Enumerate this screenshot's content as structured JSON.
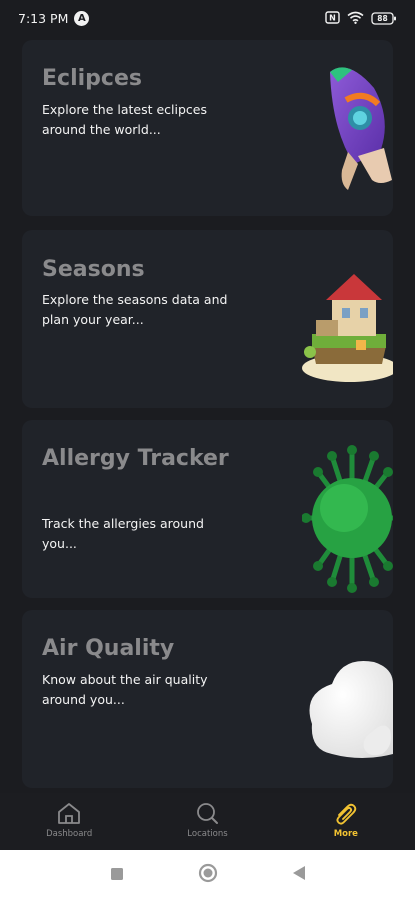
{
  "status": {
    "time": "7:13 PM",
    "launcher_badge": "A",
    "battery": "88"
  },
  "cards": [
    {
      "title": "Eclipces",
      "description": "Explore the latest eclipces around the world..."
    },
    {
      "title": "Seasons",
      "description": "Explore the seasons data and plan your year..."
    },
    {
      "title": "Allergy Tracker",
      "description": "Track the allergies around you..."
    },
    {
      "title": "Air Quality",
      "description": "Know about the air quality around you..."
    }
  ],
  "nav": {
    "items": [
      {
        "label": "Dashboard",
        "icon": "home-icon"
      },
      {
        "label": "Locations",
        "icon": "search-icon"
      },
      {
        "label": "More",
        "icon": "paperclip-icon"
      }
    ],
    "active_index": 2,
    "active_color": "#f1c232"
  },
  "theme": {
    "background": "#1b1c20",
    "card": "#202329",
    "title_color": "#8a8a8c"
  }
}
